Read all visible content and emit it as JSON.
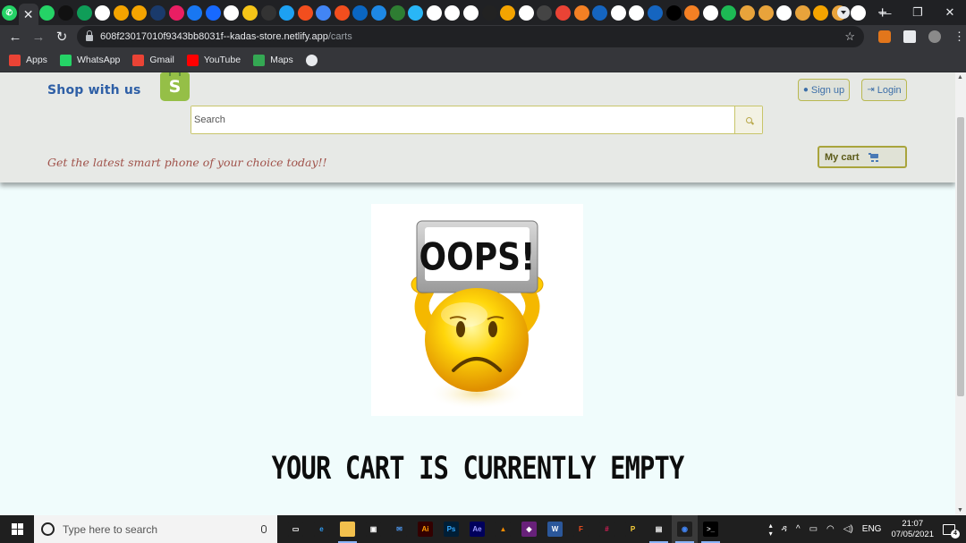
{
  "browser": {
    "tab_close_glyph": "✕",
    "new_tab_glyph": "+",
    "favicon_colors": [
      "#25d366",
      "#111111",
      "#0f9d58",
      "#ffffff",
      "#f4a400",
      "#f4a400",
      "#1a3a6b",
      "#e91e63",
      "#1877f2",
      "#1769ff",
      "#ffffff",
      "#f5c518",
      "#333333",
      "#1da1f2",
      "#f24e1e",
      "#4285f4",
      "#f24e1e",
      "#0a66c2",
      "#1e88e5",
      "#2e7d32",
      "#29b6f6",
      "#ffffff",
      "#ffffff",
      "#ffffff",
      "#222222",
      "#f4a400",
      "#ffffff",
      "#444444",
      "#ea4335",
      "#f48024",
      "#1565c0",
      "#ffffff",
      "#ffffff",
      "#1565c0",
      "#000000",
      "#f48024",
      "#ffffff",
      "#1db954",
      "#e8a33b",
      "#e8a33b",
      "#ffffff",
      "#e8a33b",
      "#f4a400",
      "#e8a33b",
      "#ffffff"
    ],
    "url_host": "608f23017010f9343bb8031f--kadas-store.netlify.app",
    "url_path": "/carts",
    "bookmarks": [
      {
        "label": "Apps",
        "icon": "apps-grid-icon",
        "color": "#ea4335"
      },
      {
        "label": "WhatsApp",
        "icon": "whatsapp-icon",
        "color": "#25d366"
      },
      {
        "label": "Gmail",
        "icon": "gmail-icon",
        "color": "#ea4335"
      },
      {
        "label": "YouTube",
        "icon": "youtube-icon",
        "color": "#ff0000"
      },
      {
        "label": "Maps",
        "icon": "maps-icon",
        "color": "#34a853"
      },
      {
        "label": "",
        "icon": "globe-icon",
        "color": "#e8eaed"
      }
    ]
  },
  "site": {
    "brand": "Shop with us",
    "bag_letter": "S",
    "signup_label": "Sign up",
    "login_label": "Login",
    "search_placeholder": "Search",
    "tagline": "Get the latest smart phone of your choice today!!",
    "cart_label": "My cart",
    "oops_text": "OOPS!",
    "empty_message": "YOUR CART IS CURRENTLY EMPTY"
  },
  "taskbar": {
    "search_placeholder": "Type here to search",
    "apps": [
      {
        "name": "task-view",
        "glyph": "▭",
        "color": "#1f1f1f",
        "fg": "#ffffff"
      },
      {
        "name": "edge",
        "glyph": "e",
        "color": "#1f1f1f",
        "fg": "#2f9af0"
      },
      {
        "name": "file-explorer",
        "glyph": "▬",
        "color": "#f2c04d",
        "fg": "#f2c04d"
      },
      {
        "name": "store",
        "glyph": "▣",
        "color": "#1f1f1f",
        "fg": "#ffffff"
      },
      {
        "name": "mail",
        "glyph": "✉",
        "color": "#1f1f1f",
        "fg": "#4a90e2"
      },
      {
        "name": "illustrator",
        "glyph": "Ai",
        "color": "#330000",
        "fg": "#ff9a00"
      },
      {
        "name": "photoshop",
        "glyph": "Ps",
        "color": "#001e36",
        "fg": "#31a8ff"
      },
      {
        "name": "after-effects",
        "glyph": "Ae",
        "color": "#00005b",
        "fg": "#9999ff"
      },
      {
        "name": "vlc",
        "glyph": "▲",
        "color": "#1f1f1f",
        "fg": "#f48b00"
      },
      {
        "name": "visual-studio",
        "glyph": "◆",
        "color": "#68217a",
        "fg": "#ffffff"
      },
      {
        "name": "word",
        "glyph": "W",
        "color": "#2b579a",
        "fg": "#ffffff"
      },
      {
        "name": "figma",
        "glyph": "F",
        "color": "#1f1f1f",
        "fg": "#f24e1e"
      },
      {
        "name": "slack",
        "glyph": "#",
        "color": "#1f1f1f",
        "fg": "#e01e5a"
      },
      {
        "name": "python",
        "glyph": "P",
        "color": "#1f1f1f",
        "fg": "#ffd43b"
      },
      {
        "name": "photos",
        "glyph": "▤",
        "color": "#1f1f1f",
        "fg": "#ffffff"
      },
      {
        "name": "chrome",
        "glyph": "◉",
        "color": "#1f1f1f",
        "fg": "#4285f4"
      },
      {
        "name": "terminal",
        "glyph": ">_",
        "color": "#000000",
        "fg": "#cccccc"
      }
    ],
    "lang": "ENG",
    "time": "21:07",
    "date": "07/05/2021",
    "notifications": "4"
  }
}
